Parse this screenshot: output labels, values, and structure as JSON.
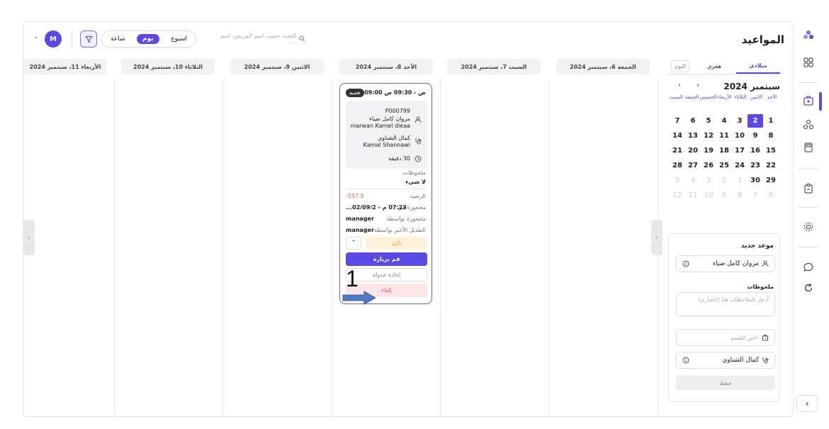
{
  "header": {
    "title": "المواعيد",
    "search_placeholder": "البحث حسب اسم المريض، اسم ...",
    "view_week": "اسبوع",
    "view_day": "يوم",
    "view_hour": "ساعة",
    "avatar_initial": "M"
  },
  "days": [
    "الجمعة 6، سبتمبر 2024",
    "السبت 7، سبتمبر 2024",
    "الأحد 8، سبتمبر 2024",
    "الاثنين 9، سبتمبر 2024",
    "الثلاثاء 10، سبتمبر 2024",
    "الأربعاء 11، سبتمبر 2024"
  ],
  "calendar": {
    "tab_gregorian": "ميلادي",
    "tab_hijri": "هجري",
    "tab_today": "اليوم",
    "month": "سبتمبر 2024",
    "weekdays": [
      "الأحد",
      "الاثنين",
      "الثلاثاء",
      "الأربعاء",
      "الخميس",
      "الجمعة",
      "السبت"
    ],
    "weeks": [
      [
        "1",
        "2",
        "3",
        "4",
        "5",
        "6",
        "7"
      ],
      [
        "8",
        "9",
        "10",
        "11",
        "12",
        "13",
        "14"
      ],
      [
        "15",
        "16",
        "17",
        "18",
        "19",
        "20",
        "21"
      ],
      [
        "22",
        "23",
        "24",
        "25",
        "26",
        "27",
        "28"
      ],
      [
        "29",
        "30",
        "1",
        "2",
        "3",
        "4",
        "5"
      ],
      [
        "6",
        "7",
        "8",
        "9",
        "10",
        "11",
        "12"
      ]
    ],
    "selected": "2"
  },
  "new_appointment": {
    "title": "موعد جديد",
    "patient": "مروان كامل ضياء",
    "notes_label": "ملحوظات",
    "notes_placeholder": "أدخل الملاحظات هنا (اختياري)",
    "department_placeholder": "اختر القسم",
    "doctor": "كمال الشناوي",
    "save": "حفظ"
  },
  "appointment": {
    "time": "ص - 09:30 ص 09:00",
    "badge": "جديد",
    "patient_id": "P000799",
    "patient_ar": "مروان كامل ضياء",
    "patient_en": "marwan Kamel dieaa",
    "doctor_ar": "كمال الشناوي",
    "doctor_en": "Kamal Shannawi",
    "duration": "30 دقيقة",
    "notes_label": "ملحوظات",
    "notes_value": "لا شيء",
    "balance_label": "الرصيد",
    "balance_value": "557.5-",
    "booked_at_label": "محجوزة في",
    "booked_at_value": "07:23 م - 02/09/2...",
    "booked_by_label": "محجوزة بواسطة",
    "booked_by_value": "manager",
    "edited_by_label": "التعديل الأخير بواسطة",
    "edited_by_value": "manager",
    "confirm": "تأكيد",
    "visit": "قم بزيارة",
    "reschedule": "إعادة جدولة",
    "cancel": "إلغاء"
  },
  "annotation": {
    "number": "1"
  },
  "colors": {
    "accent": "#5b48e8",
    "danger": "#e25a6c",
    "warning": "#e8a640"
  }
}
